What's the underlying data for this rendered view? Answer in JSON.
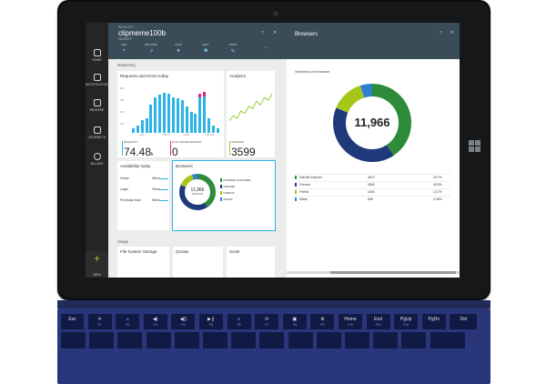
{
  "colors": {
    "azure_header": "#3b4c59",
    "accent_blue": "#2cb4e6",
    "pink": "#e0267d",
    "keyboard": "#29367a"
  },
  "sidebar": {
    "items": [
      {
        "label": "HOME",
        "icon": "home-icon"
      },
      {
        "label": "NOTIFICATIONS",
        "icon": "notifications-icon"
      },
      {
        "label": "BROWSE",
        "icon": "browse-icon"
      },
      {
        "label": "JOURNEYS",
        "icon": "journeys-icon"
      },
      {
        "label": "BILLING",
        "icon": "billing-icon"
      }
    ],
    "new_label": "NEW"
  },
  "blade1": {
    "subtitle": "WEBSITE",
    "title": "clipmeme100b",
    "type": "WEBSITE",
    "toolbar": [
      {
        "label": "ADD",
        "glyph": "+"
      },
      {
        "label": "BROWSE",
        "glyph": "↗"
      },
      {
        "label": "STOP",
        "glyph": "●"
      },
      {
        "label": "EDIT",
        "glyph": "■"
      },
      {
        "label": "SWAP",
        "glyph": "✎"
      },
      {
        "label": "",
        "glyph": "…"
      }
    ],
    "monitoring_label": "Monitoring",
    "requests_title": "Requests and errors today",
    "analytics_title": "Analytics",
    "metrics": [
      {
        "label": "REQUESTS",
        "value": "74.48",
        "unit": "k",
        "color": "#2cb4e6"
      },
      {
        "label": "HTTP SERVER ERRORS",
        "value": "0",
        "unit": "",
        "color": "#e0267d"
      },
      {
        "label": "SESSIONS",
        "value": "3599",
        "unit": "",
        "color": "#9acd32"
      }
    ],
    "availability_title": "Availability today",
    "availability_rows": [
      {
        "name": "Home",
        "value": "96xxx"
      },
      {
        "name": "Login",
        "value": "39xxx"
      },
      {
        "name": "Purchase flow",
        "value": "96xxx"
      }
    ],
    "browsers_tile_title": "Browsers",
    "browsers_tile_total": "11,966",
    "browsers_tile_total_label": "SESSIONS",
    "browsers_tile_legend": [
      "INTERNET EXPLORER",
      "CHROME",
      "FIREFOX",
      "SAFARI"
    ],
    "usage_label": "Usage",
    "usage_tiles": [
      "File System Storage",
      "Quotas",
      "Scale"
    ]
  },
  "blade2": {
    "title": "Browsers",
    "subtitle": "Sessions per browser",
    "total": "11,966",
    "rows": [
      {
        "name": "Internet Explorer",
        "value": "4870",
        "pct": "40.7%",
        "color": "#2e8b3a"
      },
      {
        "name": "Chrome",
        "value": "4848",
        "pct": "40.5%",
        "color": "#1f3a7a"
      },
      {
        "name": "Firefox",
        "value": "1640",
        "pct": "13.7%",
        "color": "#a6c61a"
      },
      {
        "name": "Safari",
        "value": "608",
        "pct": "0.06%",
        "color": "#2e7fd0"
      }
    ]
  },
  "chart_data": [
    {
      "type": "bar",
      "title": "Requests and errors today",
      "x_tick_labels": [
        "600",
        "TUE 13",
        "1200",
        "600 PM"
      ],
      "y_tick_labels": [
        "40K",
        "30K",
        "20K",
        "10K"
      ],
      "series": [
        {
          "values": [
            4,
            6,
            11,
            12,
            24,
            30,
            32,
            34,
            33,
            30,
            29,
            28,
            22,
            18,
            16,
            30,
            31,
            12,
            6,
            4
          ]
        },
        {
          "values": [
            0,
            0,
            0,
            0,
            0,
            0,
            0,
            0,
            0,
            0,
            0,
            0,
            0,
            0,
            0,
            3,
            4,
            0,
            0,
            0
          ]
        }
      ]
    },
    {
      "type": "line",
      "title": "Analytics",
      "series": [
        {
          "values": [
            14,
            18,
            16,
            22,
            20,
            26,
            24,
            30,
            27,
            33,
            31,
            36
          ]
        }
      ]
    },
    {
      "type": "pie",
      "title": "Sessions per browser",
      "total_label": "11,966",
      "slices": [
        {
          "label": "Internet Explorer",
          "value": 4870,
          "color": "#2e8b3a"
        },
        {
          "label": "Chrome",
          "value": 4848,
          "color": "#1f3a7a"
        },
        {
          "label": "Firefox",
          "value": 1640,
          "color": "#a6c61a"
        },
        {
          "label": "Safari",
          "value": 608,
          "color": "#2e7fd0"
        }
      ]
    }
  ],
  "keyboard": {
    "top_row": [
      {
        "label": "Esc",
        "fn": ""
      },
      {
        "label": "☀",
        "fn": "F1"
      },
      {
        "label": "☼",
        "fn": "F2"
      },
      {
        "label": "◀)",
        "fn": "F3"
      },
      {
        "label": "◀))",
        "fn": "F4"
      },
      {
        "label": "▶❙",
        "fn": "F5"
      },
      {
        "label": "⌕",
        "fn": "F6"
      },
      {
        "label": "⟳",
        "fn": "F7"
      },
      {
        "label": "▣",
        "fn": "F8"
      },
      {
        "label": "⚙",
        "fn": "F9"
      },
      {
        "label": "Home",
        "fn": "F10"
      },
      {
        "label": "End",
        "fn": "F11"
      },
      {
        "label": "PgUp",
        "fn": "F12"
      },
      {
        "label": "PgDn",
        "fn": ""
      },
      {
        "label": "Del",
        "fn": ""
      }
    ]
  }
}
